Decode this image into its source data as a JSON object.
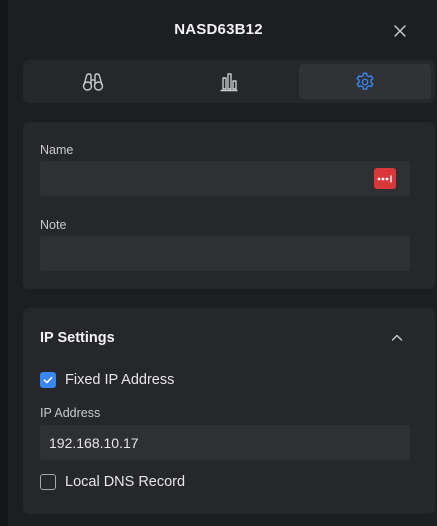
{
  "header": {
    "title": "NASD63B12"
  },
  "tabs": [
    {
      "icon": "binoculars-icon",
      "active": false
    },
    {
      "icon": "bar-chart-icon",
      "active": false
    },
    {
      "icon": "gear-icon",
      "active": true
    }
  ],
  "general": {
    "name_label": "Name",
    "name_value": "",
    "note_label": "Note",
    "note_value": ""
  },
  "ip_settings": {
    "title": "IP Settings",
    "fixed_ip_label": "Fixed IP Address",
    "fixed_ip_checked": true,
    "ip_address_label": "IP Address",
    "ip_address_value": "192.168.10.17",
    "local_dns_label": "Local DNS Record",
    "local_dns_checked": false
  },
  "colors": {
    "accent": "#3a86f0",
    "badge": "#d9383b",
    "background": "#1d1e21",
    "card": "#26272a"
  }
}
